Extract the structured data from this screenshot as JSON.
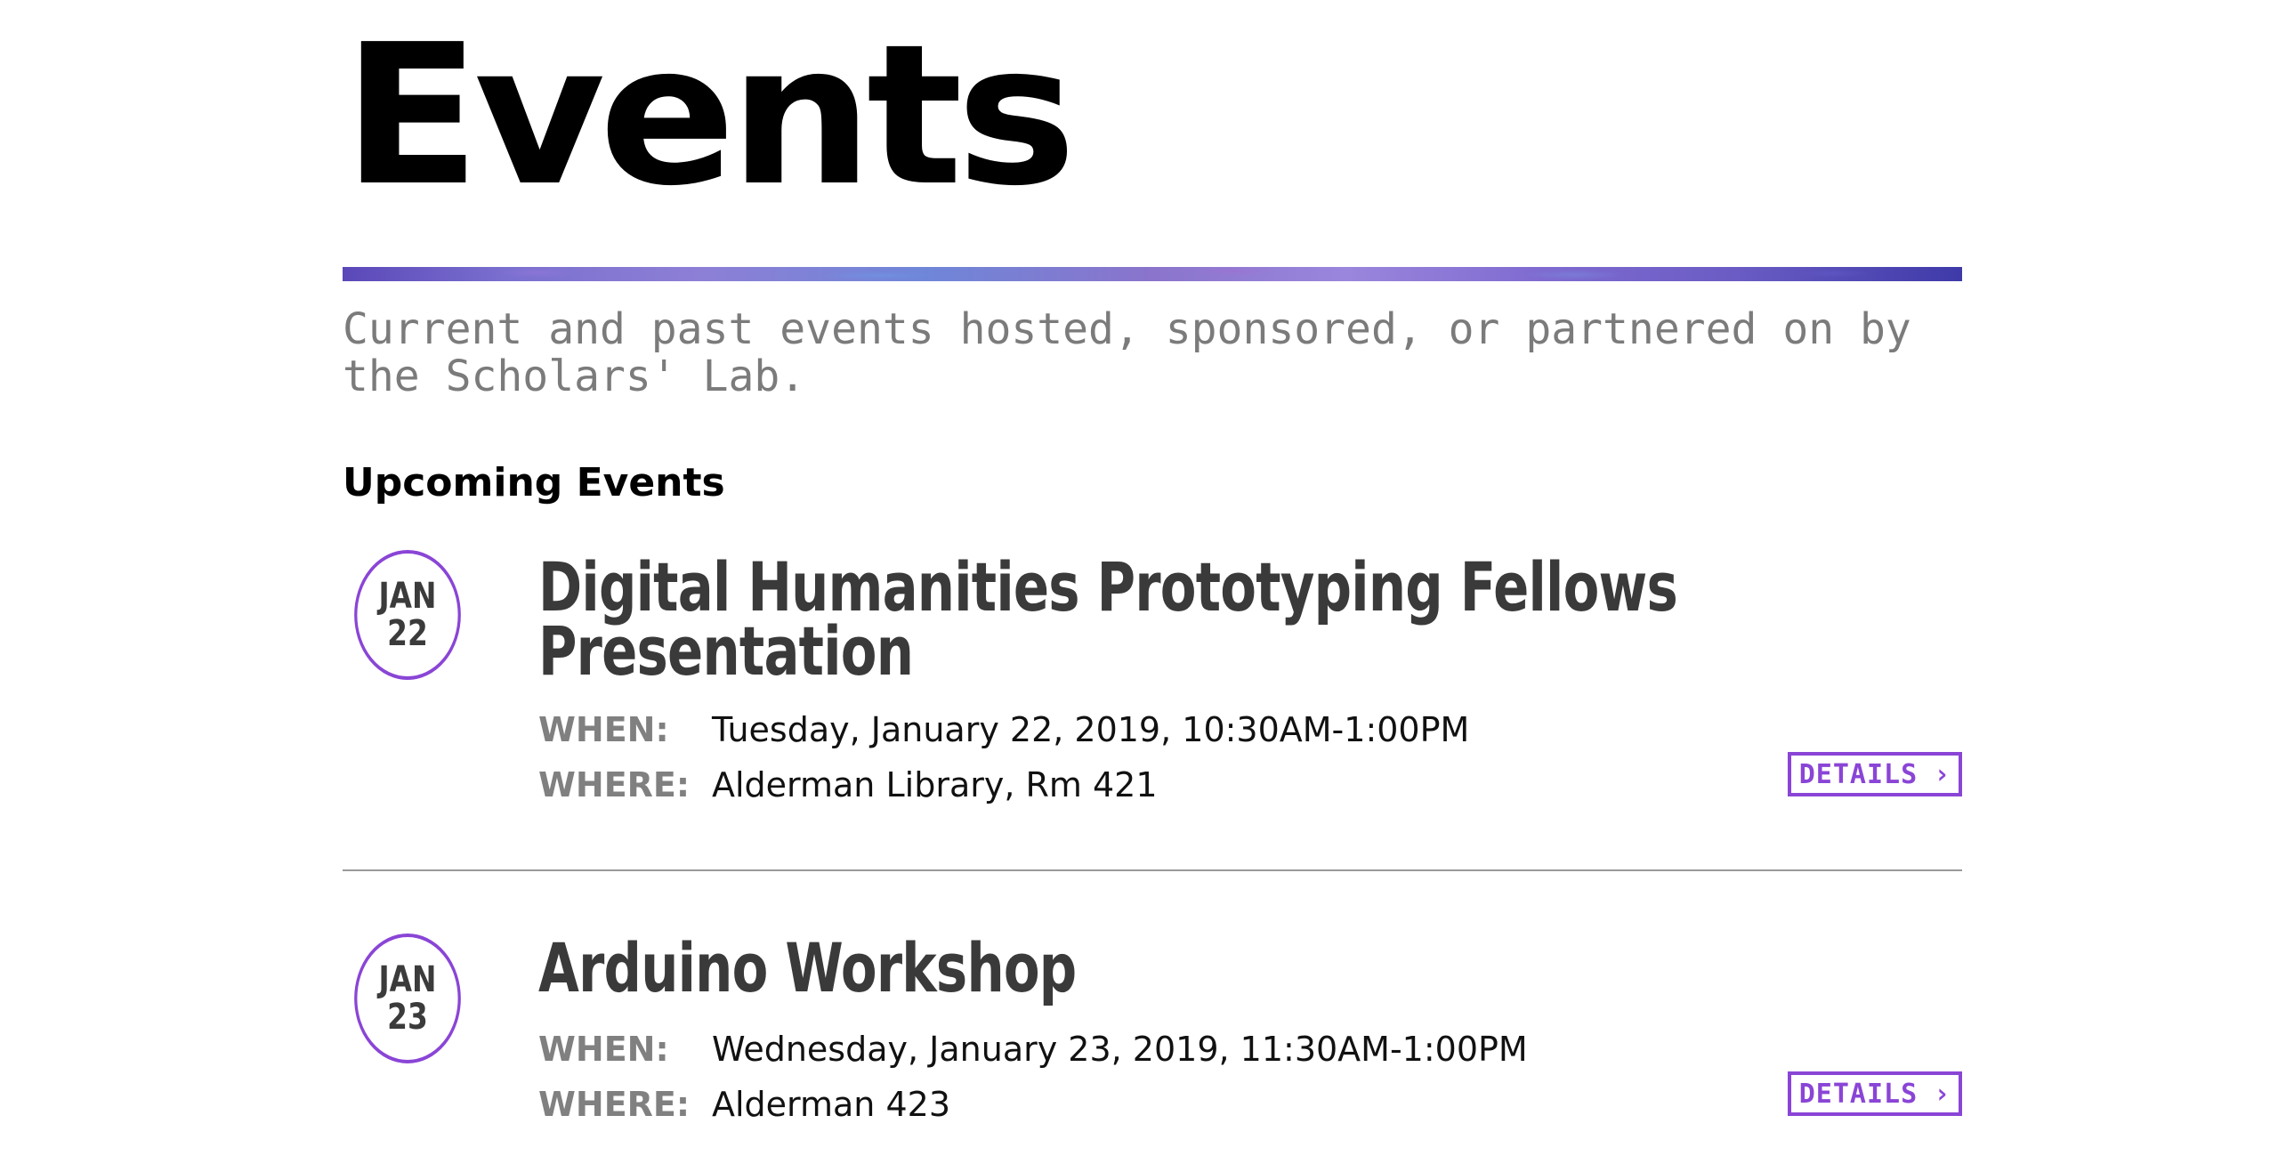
{
  "page": {
    "title": "Events",
    "description": "Current and past events hosted, sponsored, or partnered on by the Scholars' Lab."
  },
  "sections": {
    "upcoming_heading": "Upcoming Events"
  },
  "events": [
    {
      "month": "JAN",
      "day": "22",
      "title_line1": "Digital Humanities Prototyping Fellows",
      "title_line2": "Presentation",
      "when_label": "WHEN:",
      "when": "Tuesday, January 22, 2019, 10:30AM-1:00PM",
      "where_label": "WHERE:",
      "where": "Alderman Library, Rm 421",
      "details_label": "DETAILS",
      "details_icon": "›"
    },
    {
      "month": "JAN",
      "day": "23",
      "title_line1": "Arduino Workshop",
      "when_label": "WHEN:",
      "when": "Wednesday, January 23, 2019, 11:30AM-1:00PM",
      "where_label": "WHERE:",
      "where": "Alderman 423",
      "details_label": "DETAILS",
      "details_icon": "›"
    }
  ],
  "colors": {
    "accent": "#8a45d6",
    "title": "#3a3a3a",
    "label": "#808080",
    "lede": "#7b7b7b",
    "divider": "#9a9a9a"
  }
}
